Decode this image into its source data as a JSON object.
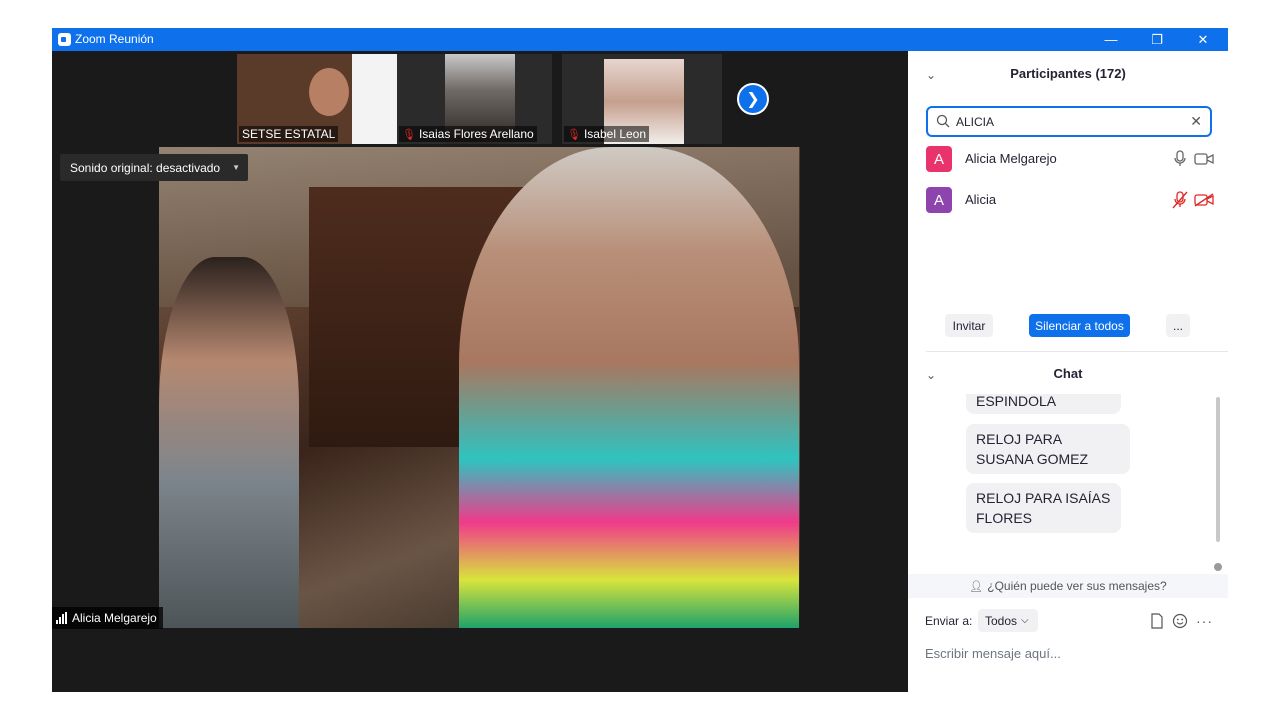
{
  "window": {
    "title": "Zoom Reunión"
  },
  "thumbnails": [
    {
      "name": "SETSE ESTATAL",
      "muted": false
    },
    {
      "name": "Isaias Flores Arellano",
      "muted": true
    },
    {
      "name": "Isabel Leon",
      "muted": true
    }
  ],
  "audio": {
    "original_sound_label": "Sonido original: desactivado"
  },
  "active_speaker": {
    "name": "Alicia Melgarejo"
  },
  "participants": {
    "title": "Participantes (172)",
    "search_value": "ALICIA",
    "list": [
      {
        "initial": "A",
        "name": "Alicia Melgarejo",
        "avatar_color": "#e8336d",
        "mic_muted": false,
        "video_off": false
      },
      {
        "initial": "A",
        "name": "Alicia",
        "avatar_color": "#8e44ad",
        "mic_muted": true,
        "video_off": true
      }
    ],
    "invite_label": "Invitar",
    "mute_all_label": "Silenciar a todos",
    "more_label": "..."
  },
  "chat": {
    "title": "Chat",
    "messages": [
      "ESPINDOLA",
      "RELOJ PARA SUSANA GOMEZ",
      "RELOJ PARA  ISAÍAS FLORES"
    ],
    "visibility_label": "¿Quién puede ver sus mensajes?",
    "send_to_label": "Enviar a:",
    "recipient": "Todos",
    "input_placeholder": "Escribir mensaje aquí..."
  },
  "colors": {
    "accent": "#0e71eb",
    "muted_red": "#e02828"
  },
  "icons": [
    "zoom-logo-icon",
    "minimize-icon",
    "restore-icon",
    "close-icon",
    "chevron-right-icon",
    "mic-muted-icon",
    "signal-bars-icon",
    "chevron-down-icon",
    "search-icon",
    "clear-icon",
    "mic-icon",
    "camera-icon",
    "person-lock-icon",
    "file-icon",
    "emoji-icon",
    "more-icon"
  ]
}
